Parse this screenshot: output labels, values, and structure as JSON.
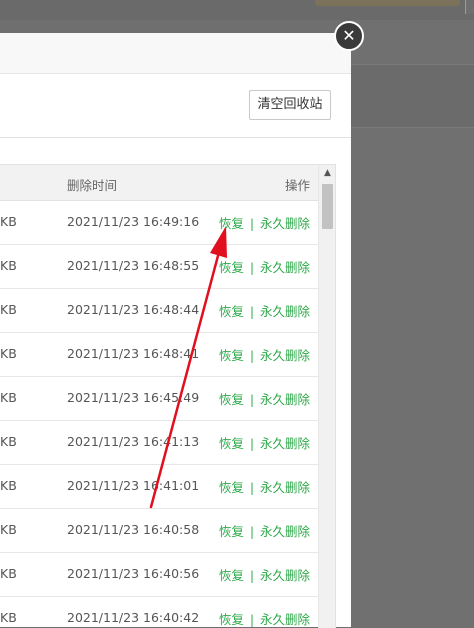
{
  "toolbar": {
    "clear_label": "清空回收站"
  },
  "table": {
    "headers": {
      "time": "删除时间",
      "ops": "操作"
    },
    "rows": [
      {
        "size": "KB",
        "time": "2021/11/23 16:49:16"
      },
      {
        "size": "KB",
        "time": "2021/11/23 16:48:55"
      },
      {
        "size": "KB",
        "time": "2021/11/23 16:48:44"
      },
      {
        "size": "KB",
        "time": "2021/11/23 16:48:41"
      },
      {
        "size": "KB",
        "time": "2021/11/23 16:45:49"
      },
      {
        "size": "KB",
        "time": "2021/11/23 16:41:13"
      },
      {
        "size": "KB",
        "time": "2021/11/23 16:41:01"
      },
      {
        "size": "KB",
        "time": "2021/11/23 16:40:58"
      },
      {
        "size": "KB",
        "time": "2021/11/23 16:40:56"
      },
      {
        "size": "KB",
        "time": "2021/11/23 16:40:42"
      }
    ],
    "actions": {
      "restore": "恢复",
      "separator": "|",
      "delete": "永久删除"
    }
  },
  "close": {
    "icon": "close-icon",
    "glyph": "✕"
  },
  "colors": {
    "action_green": "#2ea84a",
    "annotation_red": "#e0101e"
  }
}
